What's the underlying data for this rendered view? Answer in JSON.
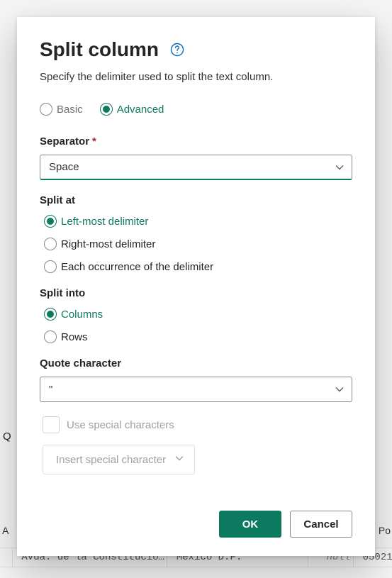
{
  "background": {
    "q_char": "Q",
    "header_left": "A",
    "header_right": "Po",
    "row2": {
      "c1": "Avda. de la Constitucio…",
      "c2": "México D.F.",
      "c3": "null",
      "c4": "05021"
    }
  },
  "dialog": {
    "title": "Split column",
    "description": "Specify the delimiter used to split the text column.",
    "mode": {
      "basic_label": "Basic",
      "advanced_label": "Advanced",
      "selected": "advanced"
    },
    "separator": {
      "label": "Separator",
      "required_mark": "*",
      "value": "Space"
    },
    "split_at": {
      "label": "Split at",
      "options": {
        "left": "Left-most delimiter",
        "right": "Right-most delimiter",
        "each": "Each occurrence of the delimiter"
      },
      "selected": "left"
    },
    "split_into": {
      "label": "Split into",
      "options": {
        "columns": "Columns",
        "rows": "Rows"
      },
      "selected": "columns"
    },
    "quote": {
      "label": "Quote character",
      "value": "\""
    },
    "special": {
      "checkbox_label": "Use special characters",
      "insert_label": "Insert special character"
    },
    "buttons": {
      "ok": "OK",
      "cancel": "Cancel"
    }
  }
}
